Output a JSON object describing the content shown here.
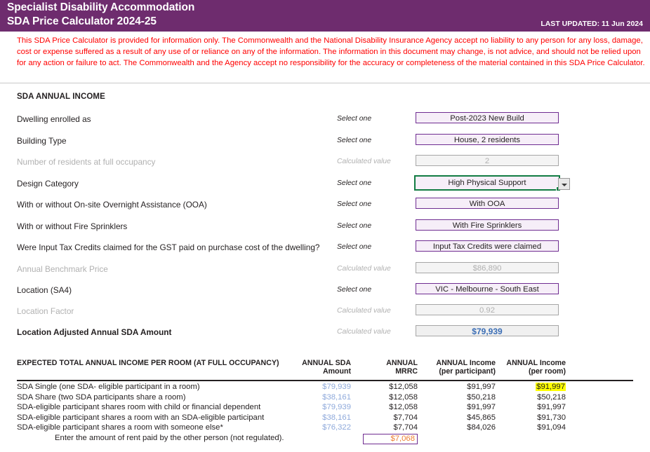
{
  "header": {
    "title_line1": "Specialist Disability Accommodation",
    "title_line2": "SDA Price Calculator 2024-25",
    "last_updated": "LAST UPDATED: 11 Jun 2024",
    "brand_color": "#6E2C6E"
  },
  "disclaimer": {
    "text": "This SDA Price Calculator is provided for information only.  The Commonwealth and the National Disability Insurance Agency accept no liability to any person for any loss, damage, cost or expense suffered as a result of any use of or reliance on any of the information.  The information in this document may change, is not advice, and should not be relied upon for any action or failure to act. The Commonwealth and the Agency accept no responsibility for the accuracy or completeness of the material contained in this SDA Price Calculator.",
    "color": "#FF0000"
  },
  "form": {
    "section_title": "SDA ANNUAL INCOME",
    "hint_select": "Select one",
    "hint_calculated": "Calculated value",
    "rows": [
      {
        "label": "Dwelling enrolled as",
        "hint": "Select one",
        "value": "Post-2023 New Build",
        "kind": "select"
      },
      {
        "label": "Building Type",
        "hint": "Select one",
        "value": "House, 2 residents",
        "kind": "select"
      },
      {
        "label": "Number of residents at full occupancy",
        "hint": "Calculated value",
        "value": "2",
        "kind": "calc"
      },
      {
        "label": "Design Category",
        "hint": "Select one",
        "value": "High Physical Support",
        "kind": "selected-cell"
      },
      {
        "label": "With or without On-site Overnight Assistance (OOA)",
        "hint": "Select one",
        "value": "With OOA",
        "kind": "select"
      },
      {
        "label": "With or without Fire Sprinklers",
        "hint": "Select one",
        "value": "With Fire Sprinklers",
        "kind": "select"
      },
      {
        "label": "Were Input Tax Credits claimed for the GST paid on purchase cost of the dwelling?",
        "hint": "Select one",
        "value": "Input Tax Credits were claimed",
        "kind": "select"
      },
      {
        "label": "Annual Benchmark Price",
        "hint": "Calculated value",
        "value": "$86,890",
        "kind": "calc"
      },
      {
        "label": "Location (SA4)",
        "hint": "Select one",
        "value": "VIC - Melbourne - South East",
        "kind": "select"
      },
      {
        "label": "Location Factor",
        "hint": "Calculated value",
        "value": "0.92",
        "kind": "calc"
      },
      {
        "label": "Location Adjusted Annual SDA Amount",
        "hint": "Calculated value",
        "value": "$79,939",
        "kind": "calc-strong"
      }
    ]
  },
  "table": {
    "title": "EXPECTED TOTAL ANNUAL INCOME PER ROOM (AT FULL OCCUPANCY)",
    "columns": [
      {
        "line1": "ANNUAL SDA",
        "line2": "Amount"
      },
      {
        "line1": "ANNUAL",
        "line2": "MRRC"
      },
      {
        "line1": "ANNUAL Income",
        "line2": "(per participant)"
      },
      {
        "line1": "ANNUAL Income",
        "line2": "(per room)"
      }
    ],
    "rows": [
      {
        "label": "SDA Single (one SDA- eligible participant in a room)",
        "sda": "$79,939",
        "mrrc": "$12,058",
        "per_participant": "$91,997",
        "per_room": "$91,997",
        "highlight_per_room": true
      },
      {
        "label": "SDA Share (two SDA participants share a room)",
        "sda": "$38,161",
        "mrrc": "$12,058",
        "per_participant": "$50,218",
        "per_room": "$50,218",
        "highlight_per_room": false
      },
      {
        "label": "SDA-eligible participant shares room with child or financial dependent",
        "sda": "$79,939",
        "mrrc": "$12,058",
        "per_participant": "$91,997",
        "per_room": "$91,997",
        "highlight_per_room": false
      },
      {
        "label": "SDA-eligible participant shares a room with an SDA-eligible participant",
        "sda": "$38,161",
        "mrrc": "$7,704",
        "per_participant": "$45,865",
        "per_room": "$91,730",
        "highlight_per_room": false
      },
      {
        "label": "SDA-eligible participant shares a room with someone else*",
        "sda": "$76,322",
        "mrrc": "$7,704",
        "per_participant": "$84,026",
        "per_room": "$91,094",
        "highlight_per_room": false
      }
    ],
    "rent_row": {
      "label": "Enter the amount of rent paid by the other person (not regulated).",
      "value": "$7,068",
      "value_color": "#ED7D31"
    }
  }
}
